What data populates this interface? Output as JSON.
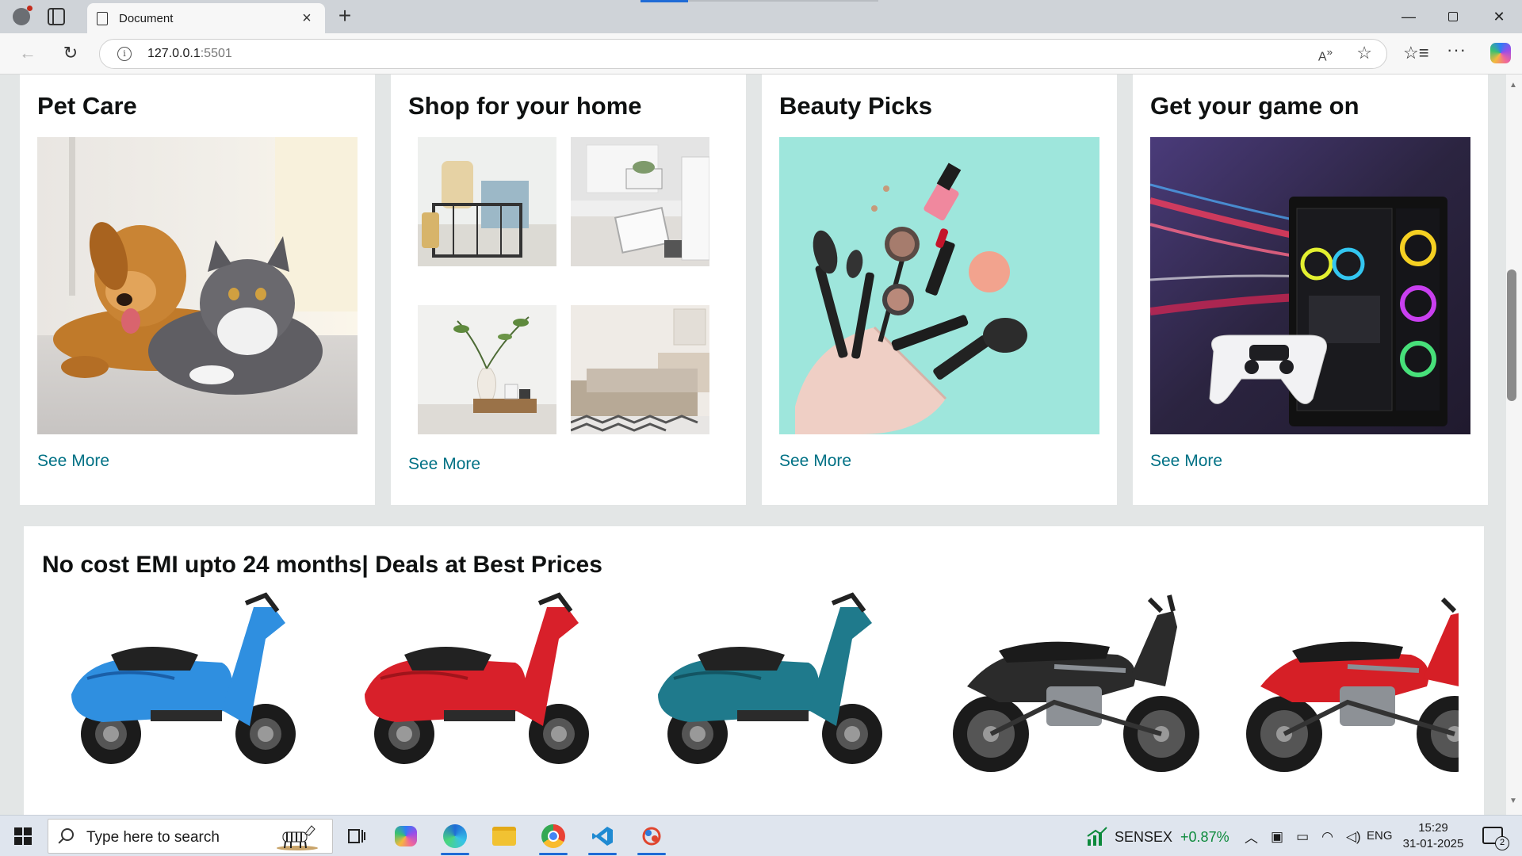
{
  "browser": {
    "tab_title": "Document",
    "url_host": "127.0.0.1",
    "url_port": ":5501",
    "read_aloud_icon": "read-aloud-icon",
    "favorite_icon": "star-icon"
  },
  "cards": [
    {
      "title": "Pet Care",
      "link": "See More"
    },
    {
      "title": "Shop for your home",
      "link": "See More"
    },
    {
      "title": "Beauty Picks",
      "link": "See More"
    },
    {
      "title": "Get your game on",
      "link": "See More"
    }
  ],
  "emi": {
    "title": "No cost EMI upto 24 months| Deals at Best Prices",
    "bikes": [
      {
        "body": "#2f8fe0",
        "accent": "#1a5fa8"
      },
      {
        "body": "#d8202a",
        "accent": "#a0141b"
      },
      {
        "body": "#1f7a8c",
        "accent": "#135563"
      },
      {
        "body": "#2b2b2b",
        "accent": "#8a8f95"
      },
      {
        "body": "#d61f26",
        "accent": "#8a8f95"
      }
    ]
  },
  "taskbar": {
    "search_placeholder": "Type here to search",
    "widget_label": "SENSEX",
    "widget_change": "+0.87%",
    "language": "ENG",
    "time": "15:29",
    "date": "31-01-2025",
    "notification_count": "2"
  }
}
